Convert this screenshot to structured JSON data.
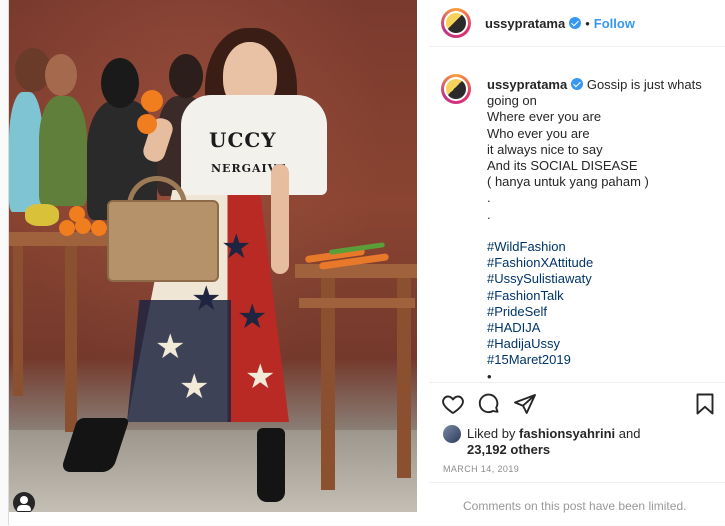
{
  "header": {
    "username": "ussypratama",
    "follow_label": "Follow",
    "dot": "•"
  },
  "caption": {
    "username": "ussypratama",
    "lines": [
      "Gossip is just whats",
      "going on",
      "Where ever you are",
      "Who ever you are",
      "it always nice to say",
      "And its SOCIAL DISEASE",
      "( hanya untuk yang paham )",
      ".",
      "."
    ],
    "hashtags": [
      "#WildFashion",
      "#FashionXAttitude",
      "#UssySulistiawaty",
      "#FashionTalk",
      "#PrideSelf",
      "#HADIJA",
      "#HadijaUssy",
      "#15Maret2019"
    ],
    "trailing": "•"
  },
  "photo": {
    "shirt_text": "UCCY",
    "shirt_subtext": "NERGAIVE"
  },
  "actions": {
    "like_icon": "heart-icon",
    "comment_icon": "comment-icon",
    "share_icon": "share-icon",
    "save_icon": "bookmark-icon"
  },
  "likes": {
    "liked_by_prefix": "Liked by",
    "liked_by_user": "fashionsyahrini",
    "and": "and",
    "others_count": "23,192 others"
  },
  "date": "MARCH 14, 2019",
  "comments_notice": "Comments on this post have been limited.",
  "colors": {
    "accent": "#3897f0",
    "hashtag": "#003569",
    "text": "#262626",
    "muted": "#8e8e8e"
  }
}
